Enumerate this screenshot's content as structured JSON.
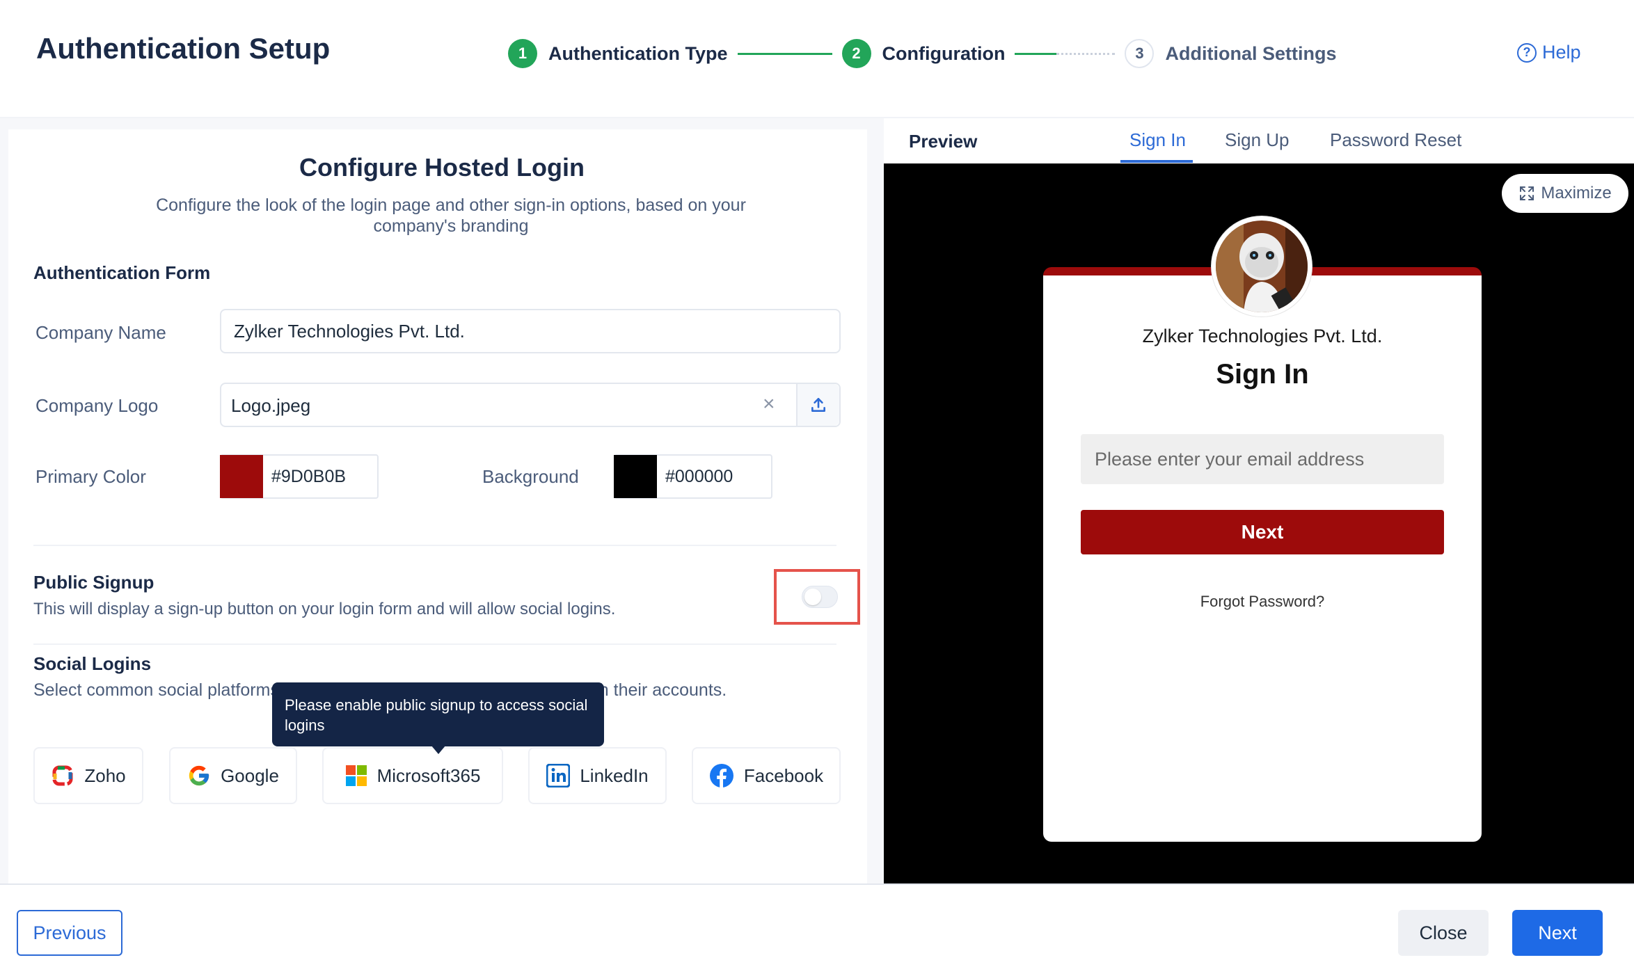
{
  "header": {
    "title": "Authentication Setup",
    "steps": [
      {
        "number": "1",
        "label": "Authentication Type",
        "status": "done"
      },
      {
        "number": "2",
        "label": "Configuration",
        "status": "done"
      },
      {
        "number": "3",
        "label": "Additional Settings",
        "status": "todo"
      }
    ],
    "help_label": "Help",
    "help_icon": "question-circle-icon"
  },
  "config": {
    "title": "Configure Hosted Login",
    "subtitle": "Configure the look of the login page and other sign-in options, based on your company's branding",
    "form_heading": "Authentication Form",
    "company_name_label": "Company Name",
    "company_name_value": "Zylker Technologies Pvt. Ltd.",
    "company_logo_label": "Company Logo",
    "company_logo_value": "Logo.jpeg",
    "primary_color_label": "Primary Color",
    "primary_color_value": "#9D0B0B",
    "primary_color": "#9d0b0b",
    "background_label": "Background",
    "background_value": "#000000",
    "background_color": "#000000",
    "public_signup_title": "Public Signup",
    "public_signup_desc": "This will display a sign-up button on your login form and will allow social logins.",
    "public_signup_enabled": false,
    "social_title": "Social Logins",
    "social_desc": "Select common social platforms from which your users can log in from with their accounts.",
    "tooltip": "Please enable public signup to access social logins",
    "social_buttons": [
      {
        "label": "Zoho",
        "icon": "zoho-icon"
      },
      {
        "label": "Google",
        "icon": "google-icon"
      },
      {
        "label": "Microsoft365",
        "icon": "microsoft-icon"
      },
      {
        "label": "LinkedIn",
        "icon": "linkedin-icon"
      },
      {
        "label": "Facebook",
        "icon": "facebook-icon"
      }
    ]
  },
  "preview": {
    "label": "Preview",
    "tabs": [
      "Sign In",
      "Sign Up",
      "Password Reset"
    ],
    "active_tab": "Sign In",
    "maximize_label": "Maximize",
    "card": {
      "company": "Zylker Technologies Pvt. Ltd.",
      "title": "Sign In",
      "email_placeholder": "Please enter your email address",
      "next_label": "Next",
      "forgot_label": "Forgot Password?"
    }
  },
  "footer": {
    "previous_label": "Previous",
    "close_label": "Close",
    "next_label": "Next"
  }
}
